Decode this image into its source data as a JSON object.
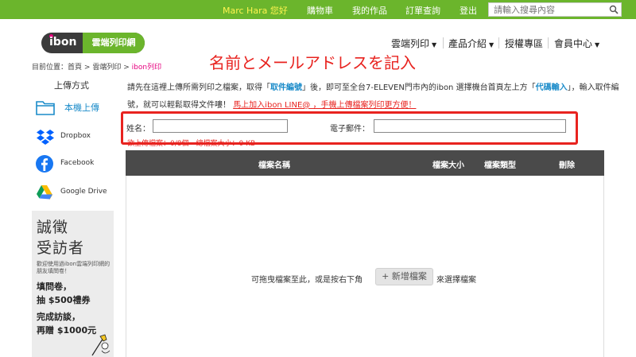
{
  "topbar": {
    "user": "Marc Hara 您好",
    "links": [
      "購物車",
      "我的作品",
      "訂單查詢",
      "登出"
    ],
    "search_placeholder": "請輸入搜尋內容"
  },
  "logo": {
    "brand": "ibon",
    "service": "雲端列印網"
  },
  "nav": [
    "雲端列印",
    "產品介紹",
    "授權專區",
    "會員中心"
  ],
  "breadcrumb": {
    "prefix": "目前位置：",
    "items": [
      "首頁",
      "雲端列印",
      "ibon列印"
    ],
    "sep": ">"
  },
  "annotation": "名前とメールアドレスを記入",
  "sidebar": {
    "title": "上傳方式",
    "items": [
      {
        "label": "本機上傳",
        "icon": "folder-icon"
      },
      {
        "label": "Dropbox",
        "icon": "dropbox-icon"
      },
      {
        "label": "Facebook",
        "icon": "facebook-icon"
      },
      {
        "label": "Google Drive",
        "icon": "google-drive-icon"
      }
    ]
  },
  "ad": {
    "title_1": "誠徵",
    "title_2": "受訪者",
    "desc": "歡迎使用過ibon雲端列印網的朋友填問卷！",
    "line_1": "填問卷，",
    "line_2": "抽 $500禮券",
    "line_3": "完成訪談，",
    "line_4": "再贈 $1000元"
  },
  "intro": {
    "t1": "請先在這裡上傳所需列印之檔案，取得「",
    "h1": "取件編號",
    "t2": "」後，即可至全台7-ELEVEN門市內的ibon 選擇機台首頁左上方「",
    "h2": "代碼輸入",
    "t3": "」，輸入取件編號，就可以輕鬆取得文件嘍！",
    "link": "馬上加入ibon LINE@ ，手機上傳檔案列印更方便！"
  },
  "form": {
    "name_label": "姓名：",
    "name_value": "",
    "email_label": "電子郵件：",
    "email_value": ""
  },
  "summary": "欲上傳檔案：0/8個　總檔案大小：0 KB",
  "table": {
    "headers": [
      "檔案名稱",
      "檔案大小",
      "檔案類型",
      "刪除"
    ]
  },
  "dropzone": {
    "pre": "可拖曳檔案至此，或是按右下角",
    "button": "+ 新增檔案",
    "post": "來選擇檔案"
  },
  "colors": {
    "green": "#6bb52c",
    "red": "#e8231f",
    "blue": "#1a8bc9",
    "dark": "#4a4a4a"
  }
}
